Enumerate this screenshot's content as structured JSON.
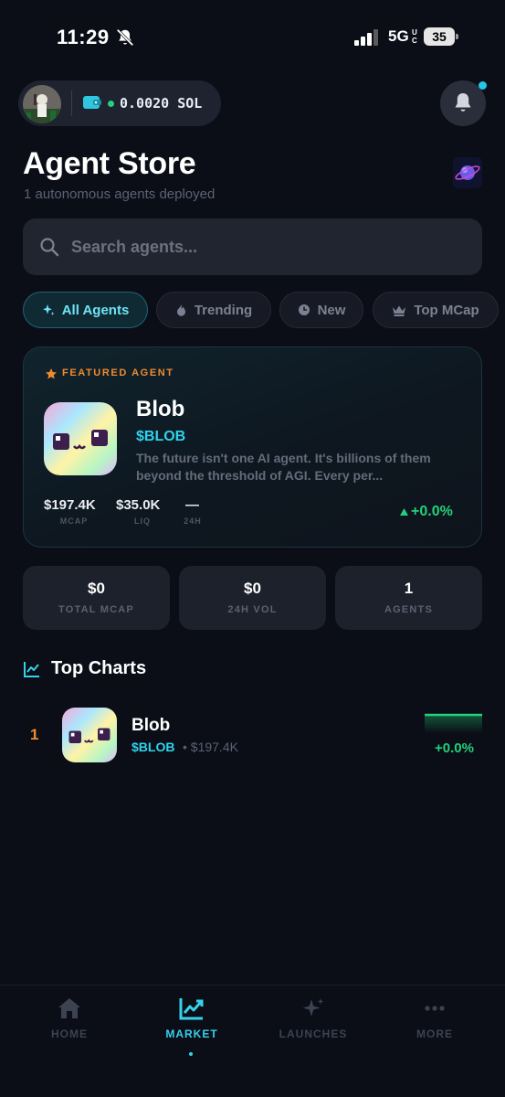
{
  "status_bar": {
    "time": "11:29",
    "network": "5G",
    "network_sub": "UC",
    "battery": "35"
  },
  "wallet": {
    "balance": "0.0020 SOL",
    "status_color": "#22d17a"
  },
  "header": {
    "title": "Agent Store",
    "subtitle": "1 autonomous agents deployed"
  },
  "search": {
    "placeholder": "Search agents..."
  },
  "filters": [
    {
      "label": "All Agents",
      "icon": "sparkle-icon",
      "active": true
    },
    {
      "label": "Trending",
      "icon": "flame-icon",
      "active": false
    },
    {
      "label": "New",
      "icon": "clock-icon",
      "active": false
    },
    {
      "label": "Top MCap",
      "icon": "crown-icon",
      "active": false
    }
  ],
  "featured": {
    "badge": "FEATURED AGENT",
    "name": "Blob",
    "ticker": "$BLOB",
    "description": "The future isn't one AI agent. It's billions of them beyond the threshold of AGI. Every per...",
    "stats": [
      {
        "value": "$197.4K",
        "label": "MCAP"
      },
      {
        "value": "$35.0K",
        "label": "LIQ"
      },
      {
        "value": "—",
        "label": "24H"
      }
    ],
    "change": "+0.0%"
  },
  "summary": [
    {
      "value": "$0",
      "label": "TOTAL MCAP"
    },
    {
      "value": "$0",
      "label": "24H VOL"
    },
    {
      "value": "1",
      "label": "AGENTS"
    }
  ],
  "top_charts": {
    "title": "Top Charts",
    "rows": [
      {
        "rank": "1",
        "name": "Blob",
        "ticker": "$BLOB",
        "mcap": "• $197.4K",
        "change": "+0.0%"
      }
    ]
  },
  "nav": [
    {
      "label": "HOME",
      "icon": "home-icon",
      "active": false
    },
    {
      "label": "MARKET",
      "icon": "chart-icon",
      "active": true
    },
    {
      "label": "LAUNCHES",
      "icon": "sparkle-icon",
      "active": false
    },
    {
      "label": "MORE",
      "icon": "more-icon",
      "active": false
    }
  ],
  "colors": {
    "accent": "#36d2ec",
    "positive": "#22d17a",
    "highlight": "#f08a2e",
    "background": "#0b0e17"
  }
}
